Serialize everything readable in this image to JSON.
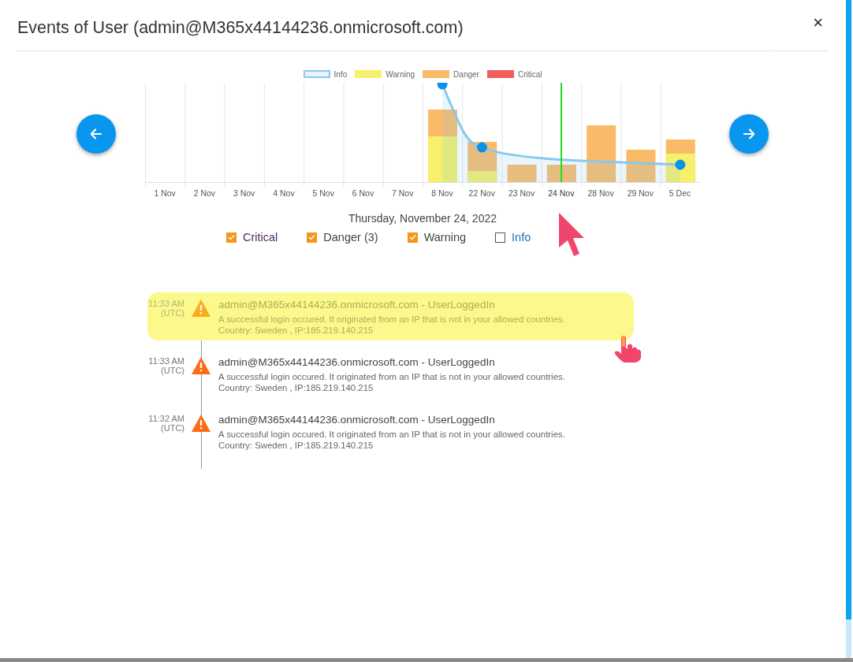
{
  "window": {
    "title": "Events of User (admin@M365x44144236.onmicrosoft.com)",
    "close": "×"
  },
  "chart": {
    "legend": [
      {
        "label": "Info",
        "color": "#88c8ee",
        "kind": "outline"
      },
      {
        "label": "Warning",
        "color": "#f6f06a",
        "kind": "fill"
      },
      {
        "label": "Danger",
        "color": "#f9bb68",
        "kind": "fill"
      },
      {
        "label": "Critical",
        "color": "#f45d5d",
        "kind": "fill"
      }
    ],
    "categories": [
      {
        "label": "1 Nov",
        "selected": false
      },
      {
        "label": "2 Nov",
        "selected": false
      },
      {
        "label": "3 Nov",
        "selected": false
      },
      {
        "label": "4 Nov",
        "selected": false
      },
      {
        "label": "5 Nov",
        "selected": false
      },
      {
        "label": "6 Nov",
        "selected": false
      },
      {
        "label": "7 Nov",
        "selected": false
      },
      {
        "label": "8 Nov",
        "selected": false
      },
      {
        "label": "22 Nov",
        "selected": false
      },
      {
        "label": "23 Nov",
        "selected": false
      },
      {
        "label": "24 Nov",
        "selected": true
      },
      {
        "label": "28 Nov",
        "selected": false
      },
      {
        "label": "29 Nov",
        "selected": false
      },
      {
        "label": "5 Dec",
        "selected": false
      }
    ]
  },
  "selected_date": "Thursday, November 24, 2022",
  "filters": [
    {
      "label": "Critical",
      "checked": true,
      "color": "#4b2c5e"
    },
    {
      "label": "Danger (3)",
      "checked": true,
      "color": "#444444"
    },
    {
      "label": "Warning",
      "checked": true,
      "color": "#444444"
    },
    {
      "label": "Info",
      "checked": false,
      "color": "#1f6fb2"
    }
  ],
  "events": [
    {
      "time": "11:33 AM",
      "zone": "(UTC)",
      "title": "admin@M365x44144236.onmicrosoft.com - UserLoggedIn",
      "description": "A successful login occured. It originated from an IP that is not in your allowed countries.",
      "location": "Country: Sweden , IP:185.219.140.215",
      "highlighted": true
    },
    {
      "time": "11:33 AM",
      "zone": "(UTC)",
      "title": "admin@M365x44144236.onmicrosoft.com - UserLoggedIn",
      "description": "A successful login occured. It originated from an IP that is not in your allowed countries.",
      "location": "Country: Sweden , IP:185.219.140.215",
      "highlighted": false
    },
    {
      "time": "11:32 AM",
      "zone": "(UTC)",
      "title": "admin@M365x44144236.onmicrosoft.com - UserLoggedIn",
      "description": "A successful login occured. It originated from an IP that is not in your allowed countries.",
      "location": "Country: Sweden , IP:185.219.140.215",
      "highlighted": false
    }
  ]
}
